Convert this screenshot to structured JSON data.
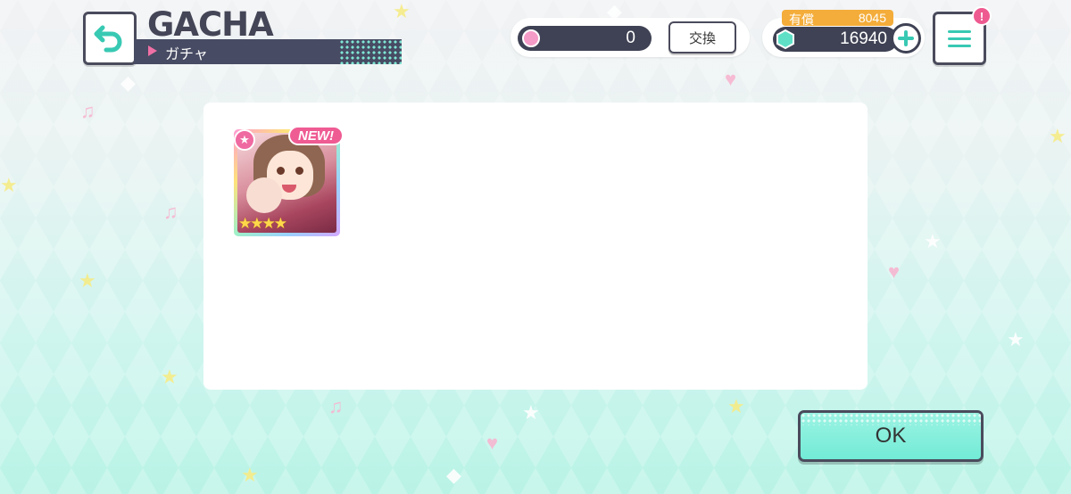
{
  "header": {
    "title": "GACHA",
    "subtitle": "ガチャ",
    "back_icon": "back-arrow-icon"
  },
  "currency": {
    "disc_amount": "0",
    "exchange_label": "交換",
    "paid_label": "有償",
    "paid_amount": "8045",
    "gem_amount": "16940"
  },
  "menu": {
    "alert_badge": "!"
  },
  "result": {
    "card": {
      "new_label": "NEW!",
      "attribute_icon": "star-attribute-icon",
      "rarity_stars": "★★★★"
    }
  },
  "footer": {
    "ok_label": "OK"
  },
  "colors": {
    "accent": "#38c9b3",
    "dark": "#3f4254",
    "pink": "#ef5b93",
    "orange": "#f4ad3a"
  }
}
